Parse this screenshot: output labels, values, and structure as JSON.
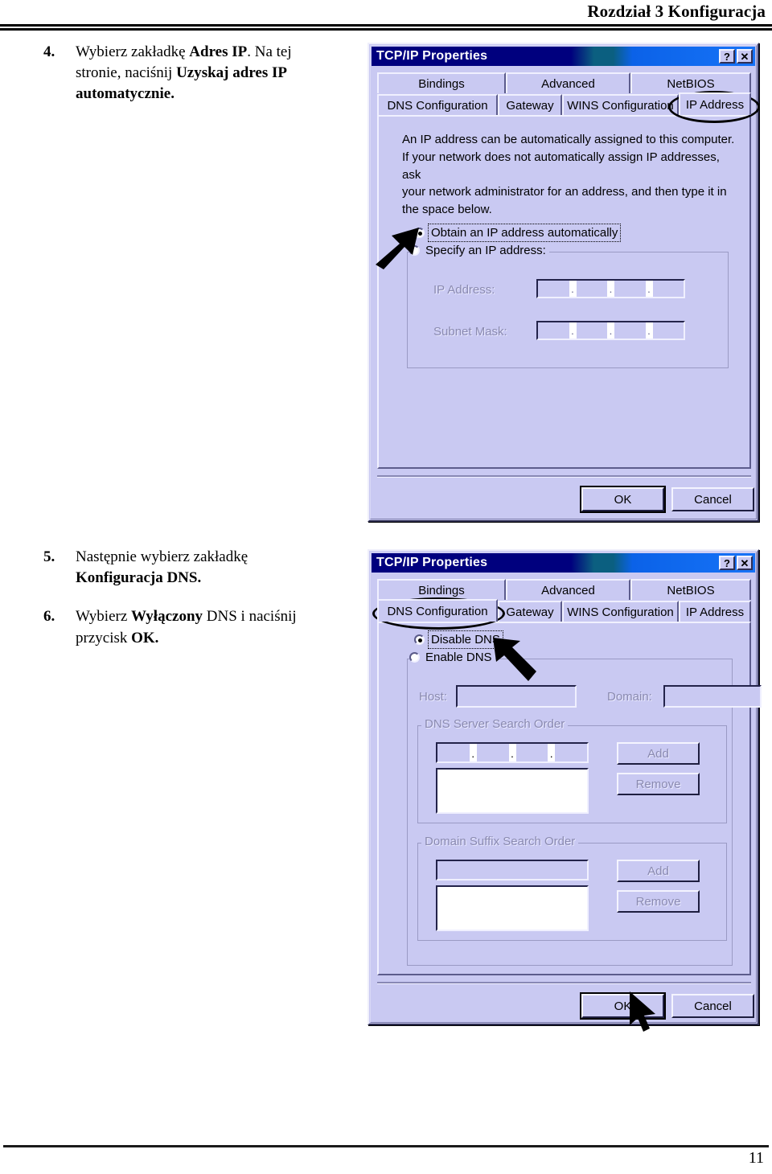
{
  "header": {
    "title": "Rozdział 3 Konfiguracja"
  },
  "footer": {
    "page_number": "11"
  },
  "colors": {
    "dialog_face": "#c9c9f2",
    "titlebar_navy": "#00007e",
    "titlebar_teal": "#0b5f80",
    "titlebar_blue": "#1673f7",
    "disabled_text": "#8a8ab0"
  },
  "steps": [
    {
      "number": "4.",
      "html": "Wybierz zakładkę <b>Adres IP</b>. Na tej stronie, naciśnij <b>Uzyskaj adres IP automatycznie.</b>"
    },
    {
      "number": "5.",
      "html": "Następnie wybierz zakładkę <b>Konfiguracja DNS.</b>"
    },
    {
      "number": "6.",
      "html": "Wybierz <b>Wyłączony</b> DNS i naciśnij przycisk <b>OK.</b>"
    }
  ],
  "dialog_ip": {
    "title": "TCP/IP Properties",
    "help_button": "?",
    "close_button": "✕",
    "tabs_row1": [
      "Bindings",
      "Advanced",
      "NetBIOS"
    ],
    "tabs_row2": [
      "DNS Configuration",
      "Gateway",
      "WINS Configuration",
      "IP Address"
    ],
    "selected_tab": "IP Address",
    "description": "An IP address can be automatically assigned to this computer.\nIf your network does not automatically assign IP addresses, ask\nyour network administrator for an address, and then type it in\nthe space below.",
    "radio_auto": "Obtain an IP address automatically",
    "radio_auto_selected": true,
    "radio_specify": "Specify an IP address:",
    "radio_specify_selected": false,
    "label_ip_address": "IP Address:",
    "label_subnet_mask": "Subnet Mask:",
    "ip_address_value": "",
    "subnet_mask_value": "",
    "octet_separator": ".",
    "ok_button": "OK",
    "cancel_button": "Cancel"
  },
  "dialog_dns": {
    "title": "TCP/IP Properties",
    "help_button": "?",
    "close_button": "✕",
    "tabs_row1": [
      "Bindings",
      "Advanced",
      "NetBIOS"
    ],
    "tabs_row2": [
      "DNS Configuration",
      "Gateway",
      "WINS Configuration",
      "IP Address"
    ],
    "selected_tab": "DNS Configuration",
    "radio_disable": "Disable DNS",
    "radio_disable_selected": true,
    "radio_enable": "Enable DNS",
    "radio_enable_selected": false,
    "label_host": "Host:",
    "label_domain": "Domain:",
    "host_value": "",
    "domain_value": "",
    "group_dns_order": "DNS Server Search Order",
    "group_domain_suffix": "Domain Suffix Search Order",
    "add_button": "Add",
    "remove_button": "Remove",
    "octet_separator": ".",
    "ok_button": "OK",
    "cancel_button": "Cancel"
  }
}
